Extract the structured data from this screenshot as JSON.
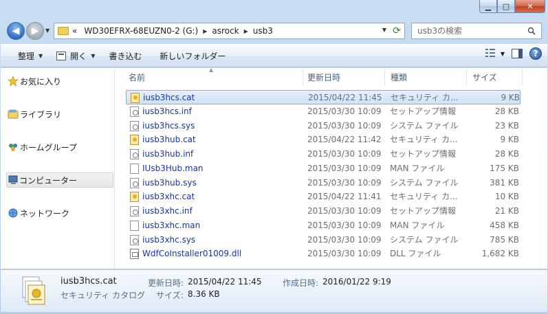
{
  "window": {
    "minimize": "▁",
    "maximize": "□",
    "close": "✕"
  },
  "address": {
    "overflow": "«",
    "crumbs": [
      "WD30EFRX-68EUZN0-2 (G:)",
      "asrock",
      "usb3"
    ]
  },
  "search": {
    "placeholder": "usb3の検索"
  },
  "toolbar": {
    "organize": "整理",
    "open": "開く",
    "burn": "書き込む",
    "new_folder": "新しいフォルダー",
    "help": "?"
  },
  "nav": {
    "favorites": "お気に入り",
    "libraries": "ライブラリ",
    "homegroup": "ホームグループ",
    "computer": "コンピューター",
    "network": "ネットワーク"
  },
  "columns": {
    "name": "名前",
    "modified": "更新日時",
    "type": "種類",
    "size": "サイズ"
  },
  "files": [
    {
      "name": "iusb3hcs.cat",
      "modified": "2015/04/22 11:45",
      "type": "セキュリティ カ...",
      "size": "9 KB",
      "icon": "cat"
    },
    {
      "name": "iusb3hcs.inf",
      "modified": "2015/03/30 10:09",
      "type": "セットアップ情報",
      "size": "28 KB",
      "icon": "inf"
    },
    {
      "name": "iusb3hcs.sys",
      "modified": "2015/03/30 10:09",
      "type": "システム ファイル",
      "size": "23 KB",
      "icon": "sys"
    },
    {
      "name": "iusb3hub.cat",
      "modified": "2015/04/22 11:42",
      "type": "セキュリティ カ...",
      "size": "9 KB",
      "icon": "cat"
    },
    {
      "name": "iusb3hub.inf",
      "modified": "2015/03/30 10:09",
      "type": "セットアップ情報",
      "size": "28 KB",
      "icon": "inf"
    },
    {
      "name": "IUsb3Hub.man",
      "modified": "2015/03/30 10:09",
      "type": "MAN ファイル",
      "size": "175 KB",
      "icon": "man"
    },
    {
      "name": "iusb3hub.sys",
      "modified": "2015/03/30 10:09",
      "type": "システム ファイル",
      "size": "381 KB",
      "icon": "sys"
    },
    {
      "name": "iusb3xhc.cat",
      "modified": "2015/04/22 11:41",
      "type": "セキュリティ カ...",
      "size": "10 KB",
      "icon": "cat"
    },
    {
      "name": "iusb3xhc.inf",
      "modified": "2015/03/30 10:09",
      "type": "セットアップ情報",
      "size": "21 KB",
      "icon": "inf"
    },
    {
      "name": "iusb3xhc.man",
      "modified": "2015/03/30 10:09",
      "type": "MAN ファイル",
      "size": "458 KB",
      "icon": "man"
    },
    {
      "name": "iusb3xhc.sys",
      "modified": "2015/03/30 10:09",
      "type": "システム ファイル",
      "size": "785 KB",
      "icon": "sys"
    },
    {
      "name": "WdfCoInstaller01009.dll",
      "modified": "2015/03/30 10:09",
      "type": "DLL ファイル",
      "size": "1,682 KB",
      "icon": "dll"
    }
  ],
  "details": {
    "filename": "iusb3hcs.cat",
    "filetype": "セキュリティ カタログ",
    "modified_label": "更新日時:",
    "modified_value": "2015/04/22 11:45",
    "created_label": "作成日時:",
    "created_value": "2016/01/22 9:19",
    "size_label": "サイズ:",
    "size_value": "8.36 KB"
  }
}
